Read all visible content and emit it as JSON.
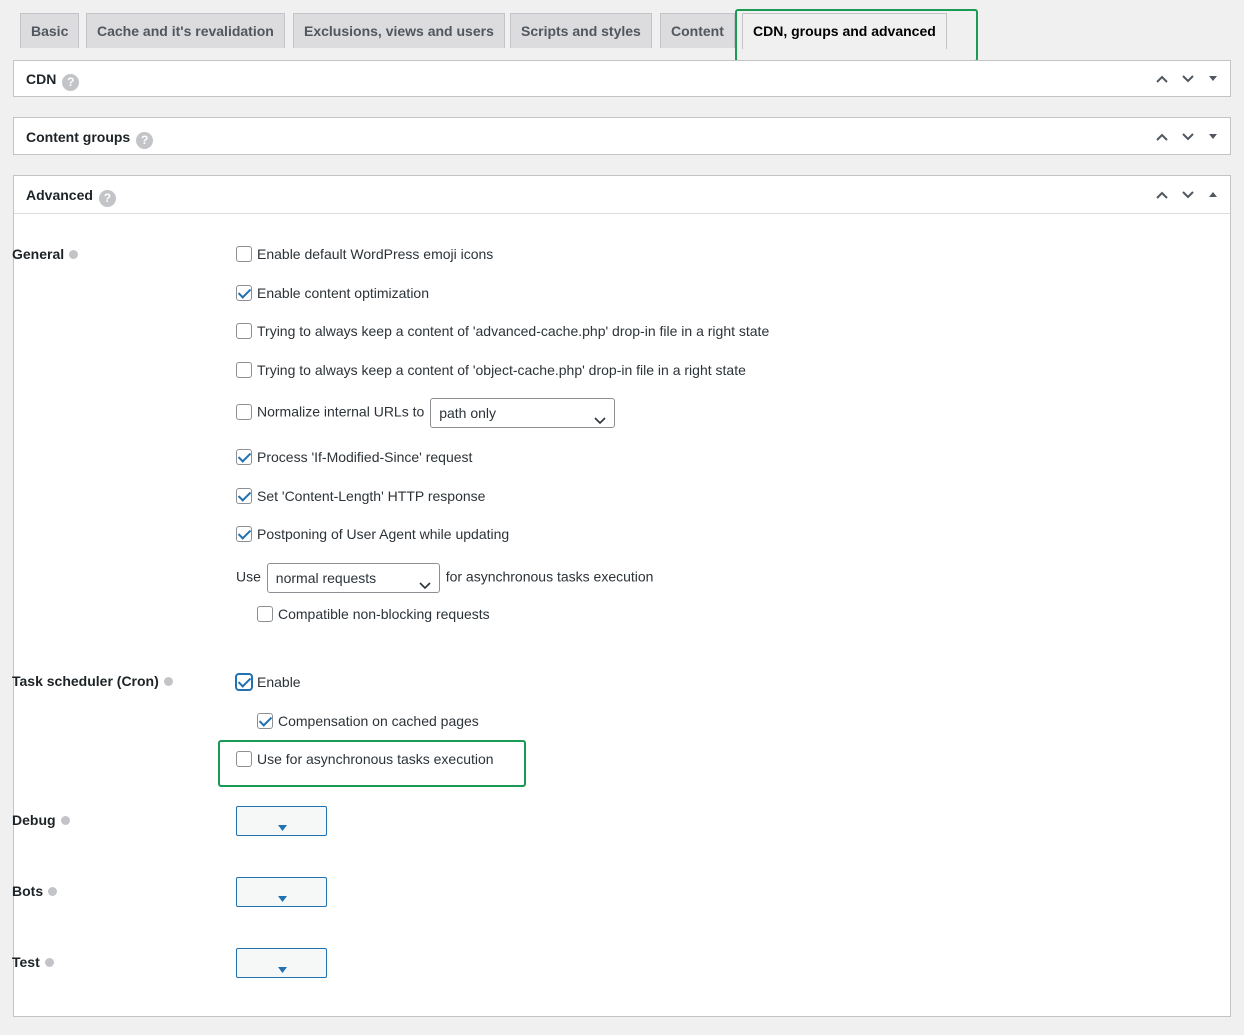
{
  "tabs": [
    {
      "label": "Basic"
    },
    {
      "label": "Cache and it's revalidation"
    },
    {
      "label": "Exclusions, views and users"
    },
    {
      "label": "Scripts and styles"
    },
    {
      "label": "Content"
    },
    {
      "label": "CDN, groups and advanced",
      "active": true
    }
  ],
  "panels": {
    "cdn": {
      "title": "CDN",
      "help": "?"
    },
    "groups": {
      "title": "Content groups",
      "help": "?"
    },
    "advanced": {
      "title": "Advanced",
      "help": "?"
    }
  },
  "advanced": {
    "general": {
      "label": "General",
      "options": [
        {
          "label": "Enable default WordPress emoji icons",
          "checked": false
        },
        {
          "label": "Enable content optimization",
          "checked": true
        },
        {
          "label": "Trying to always keep a content of 'advanced-cache.php' drop-in file in a right state",
          "checked": false
        },
        {
          "label": "Trying to always keep a content of 'object-cache.php' drop-in file in a right state",
          "checked": false
        },
        {
          "label": "Normalize internal URLs to",
          "checked": false,
          "select_value": "path only"
        },
        {
          "label": "Process 'If-Modified-Since' request",
          "checked": true
        },
        {
          "label": "Set 'Content-Length' HTTP response",
          "checked": true
        },
        {
          "label": "Postponing of User Agent while updating",
          "checked": true
        }
      ],
      "async": {
        "prefix": "Use",
        "select_value": "normal requests",
        "suffix": "for asynchronous tasks execution"
      },
      "nonblocking": {
        "label": "Compatible non-blocking requests",
        "checked": false
      }
    },
    "cron": {
      "label": "Task scheduler (Cron)",
      "enable": {
        "label": "Enable",
        "checked": true
      },
      "compensation": {
        "label": "Compensation on cached pages",
        "checked": true
      },
      "async": {
        "label": "Use for asynchronous tasks execution",
        "checked": false
      }
    },
    "debug": {
      "label": "Debug"
    },
    "bots": {
      "label": "Bots"
    },
    "test": {
      "label": "Test"
    }
  },
  "colors": {
    "accent": "#2271b1",
    "highlight": "#1a9a55"
  }
}
